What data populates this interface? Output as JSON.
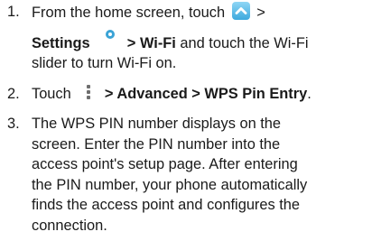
{
  "steps": [
    {
      "number": "1.",
      "line1_text": "From the home screen, touch",
      "line1_after": ">",
      "settings_label": "Settings",
      "gt1": ">",
      "wifi_label": "Wi-Fi",
      "line2_rest": "and touch the Wi-Fi",
      "line3": "slider to turn Wi-Fi on."
    },
    {
      "number": "2.",
      "touch": "Touch",
      "path": "> Advanced > WPS Pin Entry",
      "period": "."
    },
    {
      "number": "3.",
      "lines": [
        "The WPS PIN number displays on the",
        "screen. Enter the PIN number into the",
        "access point's setup page. After entering",
        "the PIN number, your phone automatically",
        "finds the access point and configures the",
        "connection."
      ]
    }
  ],
  "icons": {
    "apps": "up-arrow-icon",
    "settings": "settings-icon",
    "menu": "menu-icon"
  },
  "colors": {
    "text": "#1a1a1a",
    "app_icon_top": "#8fd6f5",
    "app_icon_bottom": "#3ea9dd",
    "settings_icon": "#3aa3d6"
  }
}
